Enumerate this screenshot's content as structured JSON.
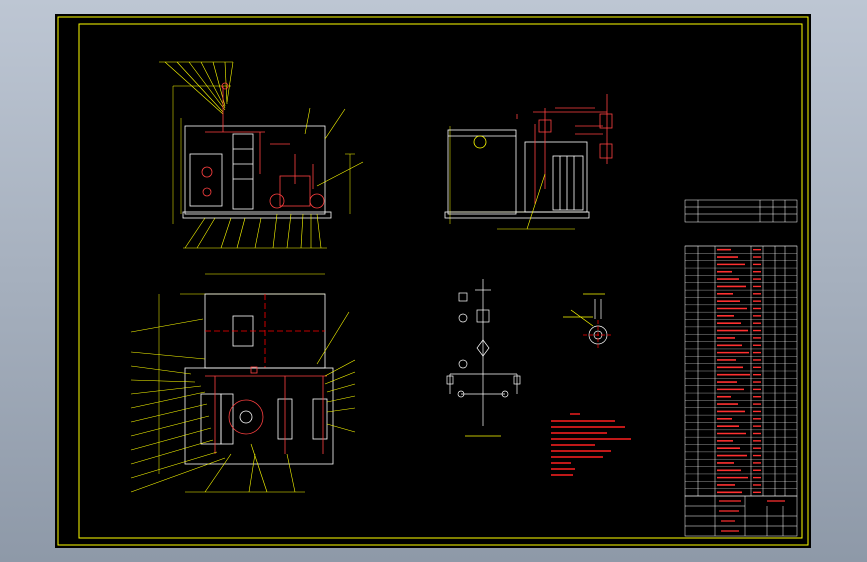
{
  "window": {
    "background_colors": [
      "#bdc6d3",
      "#8e99a8"
    ]
  },
  "drawing": {
    "type": "CAD hydraulic station assembly drawing",
    "colors": {
      "frame": "#ffff00",
      "outline": "#ffffff",
      "center_lines": "#ff0000",
      "leaders": "#ffff00",
      "notes": "#ff0000",
      "components": "#ffffff",
      "pipes": "#ff4040",
      "table_lines": "#ffffff",
      "table_text": "#ff3030"
    },
    "views": [
      "front-view",
      "side-view",
      "plan-view",
      "hydraulic-schematic",
      "detail-view"
    ],
    "notes_heading": "",
    "parts_list_rows": 34,
    "title_block_present": true
  }
}
